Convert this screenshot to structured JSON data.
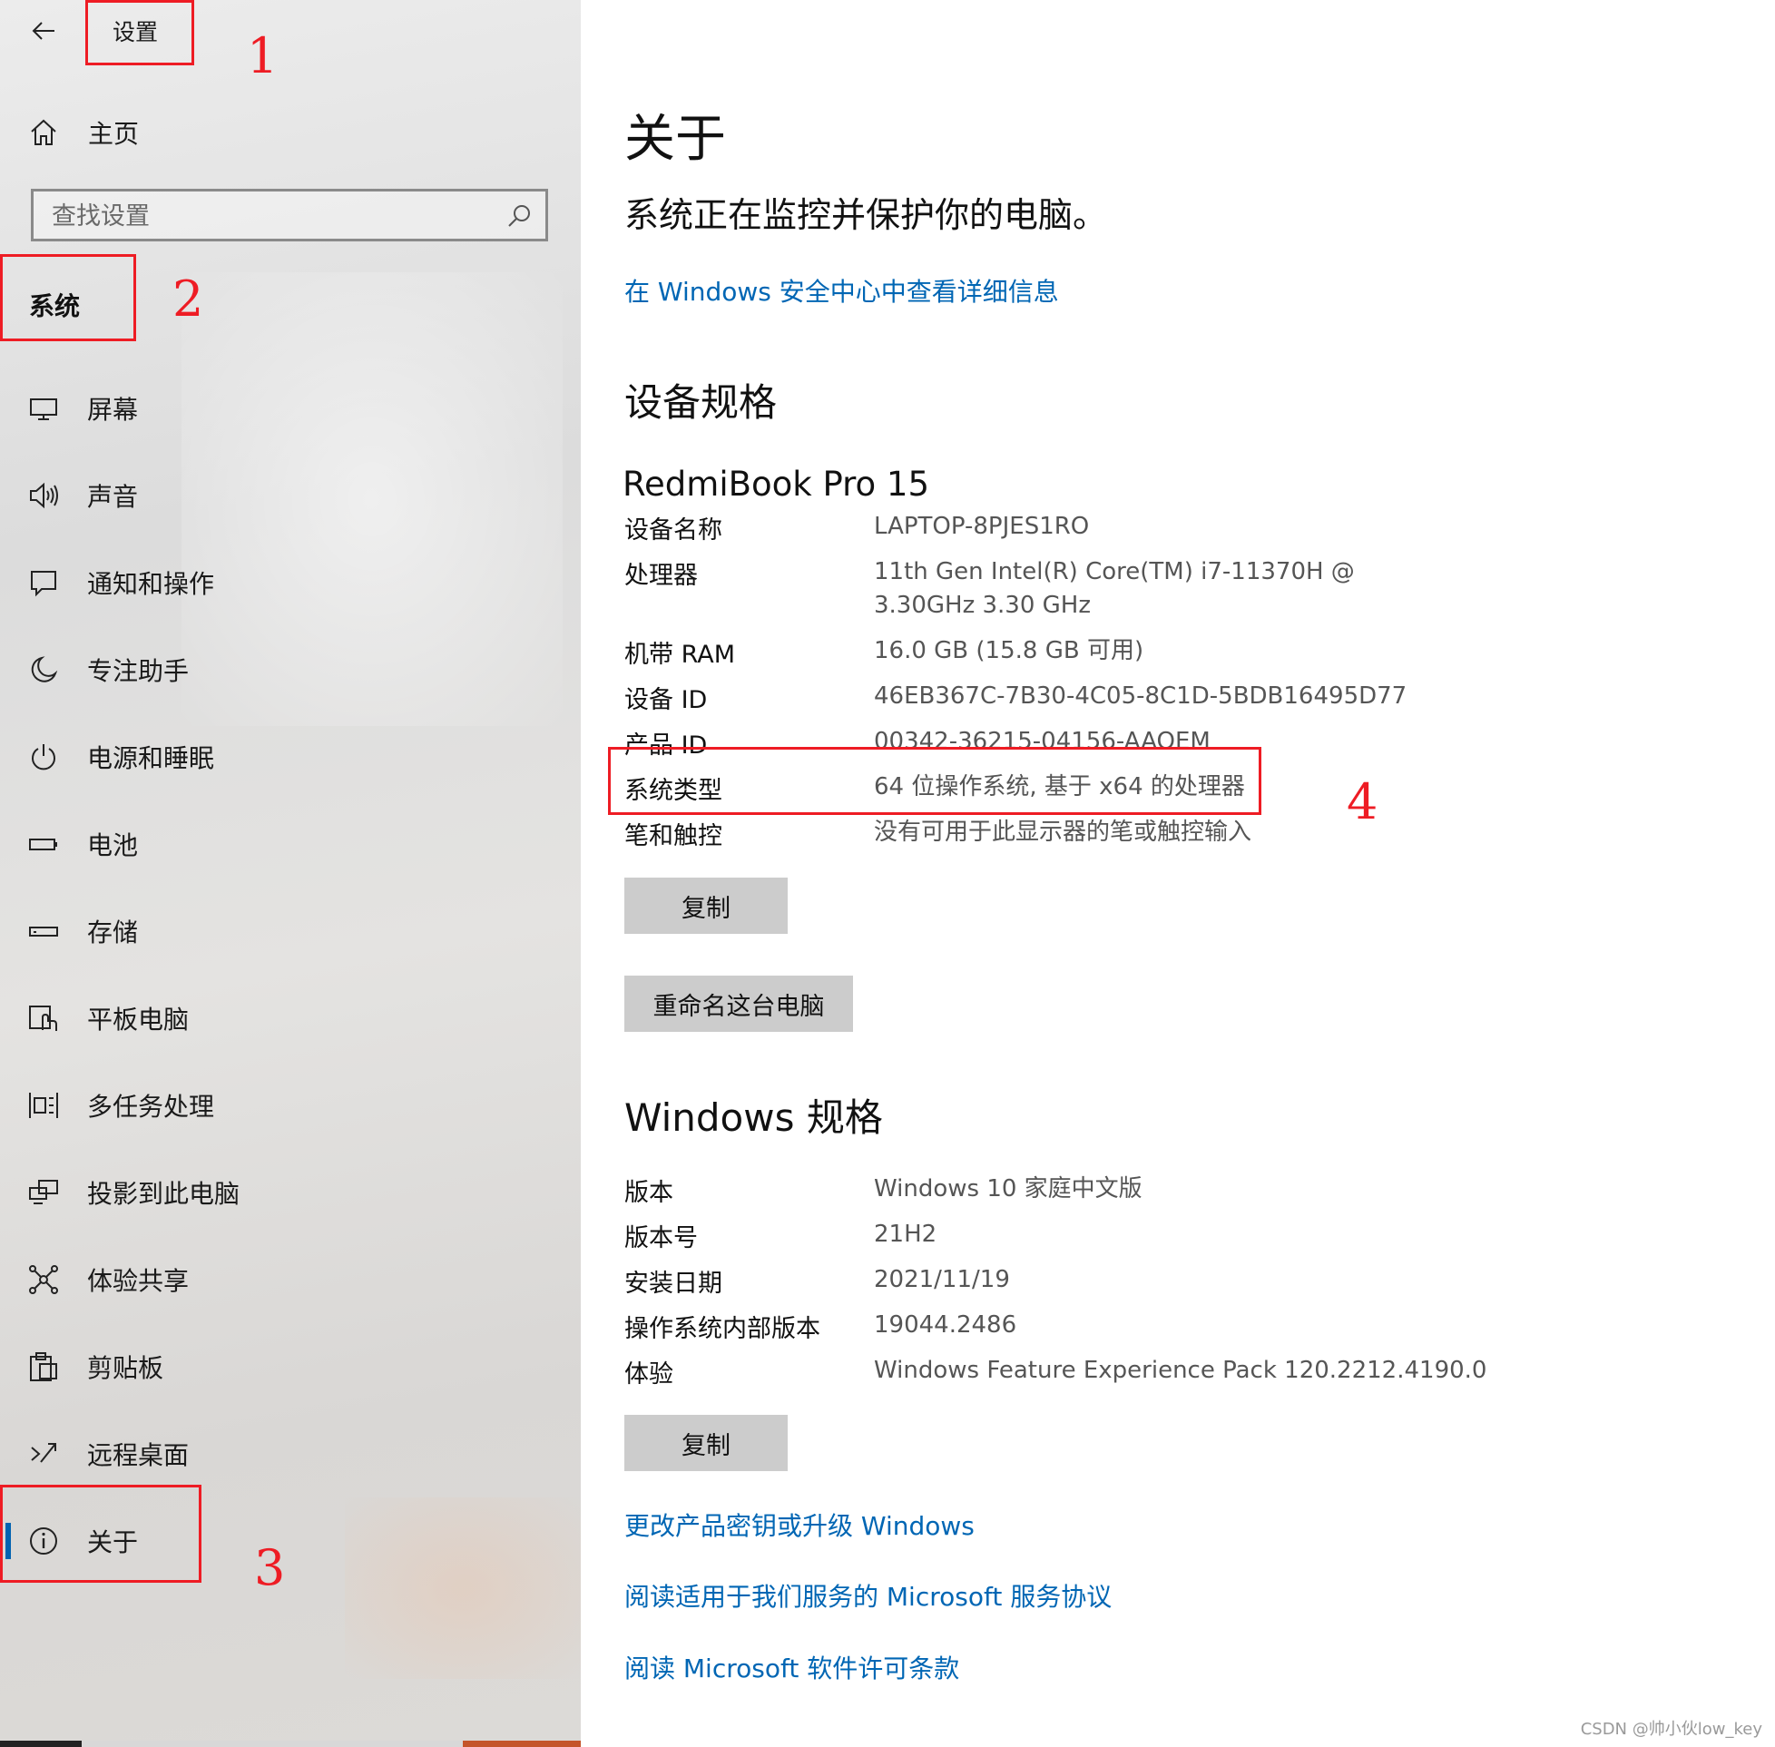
{
  "app": {
    "title": "设置"
  },
  "sidebar": {
    "home_label": "主页",
    "search_placeholder": "查找设置",
    "section_title": "系统",
    "items": [
      {
        "label": "屏幕",
        "icon": "monitor-icon"
      },
      {
        "label": "声音",
        "icon": "speaker-icon"
      },
      {
        "label": "通知和操作",
        "icon": "notification-icon"
      },
      {
        "label": "专注助手",
        "icon": "moon-icon"
      },
      {
        "label": "电源和睡眠",
        "icon": "power-icon"
      },
      {
        "label": "电池",
        "icon": "battery-icon"
      },
      {
        "label": "存储",
        "icon": "storage-icon"
      },
      {
        "label": "平板电脑",
        "icon": "tablet-icon"
      },
      {
        "label": "多任务处理",
        "icon": "multitask-icon"
      },
      {
        "label": "投影到此电脑",
        "icon": "project-icon"
      },
      {
        "label": "体验共享",
        "icon": "share-icon"
      },
      {
        "label": "剪贴板",
        "icon": "clipboard-icon"
      },
      {
        "label": "远程桌面",
        "icon": "remote-desktop-icon"
      },
      {
        "label": "关于",
        "icon": "info-icon",
        "active": true
      }
    ]
  },
  "main": {
    "title": "关于",
    "subtitle": "系统正在监控并保护你的电脑。",
    "security_link": "在 Windows 安全中心中查看详细信息",
    "device_spec_title": "设备规格",
    "device_model": "RedmiBook Pro 15",
    "device_specs": [
      {
        "key": "设备名称",
        "value": "LAPTOP-8PJES1RO"
      },
      {
        "key": "处理器",
        "value": "11th Gen Intel(R) Core(TM) i7-11370H @ 3.30GHz 3.30 GHz"
      },
      {
        "key": "机带 RAM",
        "value": "16.0 GB (15.8 GB 可用)"
      },
      {
        "key": "设备 ID",
        "value": "46EB367C-7B30-4C05-8C1D-5BDB16495D77"
      },
      {
        "key": "产品 ID",
        "value": "00342-36215-04156-AAOEM"
      },
      {
        "key": "系统类型",
        "value": "64 位操作系统, 基于 x64 的处理器"
      },
      {
        "key": "笔和触控",
        "value": "没有可用于此显示器的笔或触控输入"
      }
    ],
    "copy_label": "复制",
    "rename_label": "重命名这台电脑",
    "windows_spec_title": "Windows 规格",
    "windows_specs": [
      {
        "key": "版本",
        "value": "Windows 10 家庭中文版"
      },
      {
        "key": "版本号",
        "value": "21H2"
      },
      {
        "key": "安装日期",
        "value": "2021/11/19"
      },
      {
        "key": "操作系统内部版本",
        "value": "19044.2486"
      },
      {
        "key": "体验",
        "value": "Windows Feature Experience Pack 120.2212.4190.0"
      }
    ],
    "copy2_label": "复制",
    "links": [
      "更改产品密钥或升级 Windows",
      "阅读适用于我们服务的 Microsoft 服务协议",
      "阅读 Microsoft 软件许可条款"
    ]
  },
  "annotations": [
    "1",
    "2",
    "3",
    "4"
  ],
  "watermark": "CSDN @帅小伙low_key",
  "colors": {
    "accent": "#0066b4",
    "annotation": "#ee1c24",
    "button": "#cccccc"
  }
}
